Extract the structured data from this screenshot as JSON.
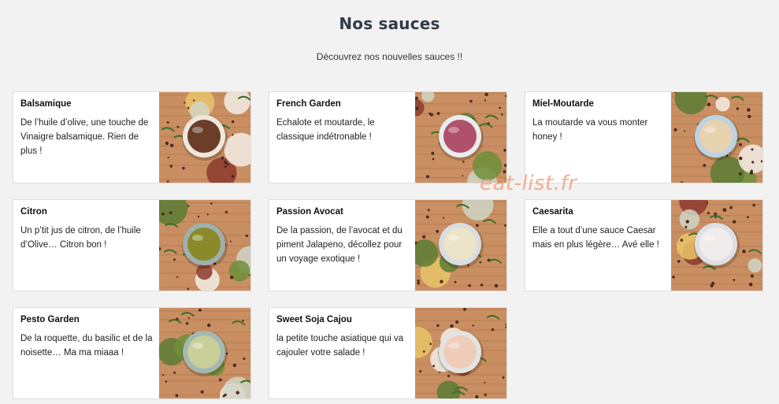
{
  "header": {
    "title": "Nos sauces",
    "subtitle": "Découvrez nos nouvelles sauces !!"
  },
  "watermark": "eat-list.fr",
  "sauces": [
    {
      "title": "Balsamique",
      "description": "De l’huile d’olive, une touche de Vinaigre balsamique. Rien de plus !",
      "sauce_color": "#6b3e2a",
      "rim_color": "#efe6dc"
    },
    {
      "title": "French Garden",
      "description": "Echalote et moutarde, le classique indétronable !",
      "sauce_color": "#b0506a",
      "rim_color": "#e9ecef"
    },
    {
      "title": "Miel-Moutarde",
      "description": "La moutarde va vous monter honey !",
      "sauce_color": "#e8d3b0",
      "rim_color": "#bcd3e3"
    },
    {
      "title": "Citron",
      "description": "Un p’tit jus de citron, de l’huile d’Olive… Citron bon !",
      "sauce_color": "#8a8a2a",
      "rim_color": "#9fb0ad"
    },
    {
      "title": "Passion Avocat",
      "description": "De la passion, de l’avocat et du piment Jalapeno, décollez pour un voyage exotique !",
      "sauce_color": "#ece4c8",
      "rim_color": "#d7dde0"
    },
    {
      "title": "Caesarita",
      "description": "Elle a tout d’une sauce Caesar mais en plus légère… Avé elle !",
      "sauce_color": "#f1ecec",
      "rim_color": "#dcdfe3"
    },
    {
      "title": "Pesto Garden",
      "description": "De la roquette, du basilic et de la noisette… Ma ma miaaa !",
      "sauce_color": "#c9cf98",
      "rim_color": "#a4b8b2"
    },
    {
      "title": "Sweet Soja Cajou",
      "description": "la petite touche asiatique qui va cajouler votre salade !",
      "sauce_color": "#efcdb8",
      "rim_color": "#e3e3e3"
    }
  ]
}
